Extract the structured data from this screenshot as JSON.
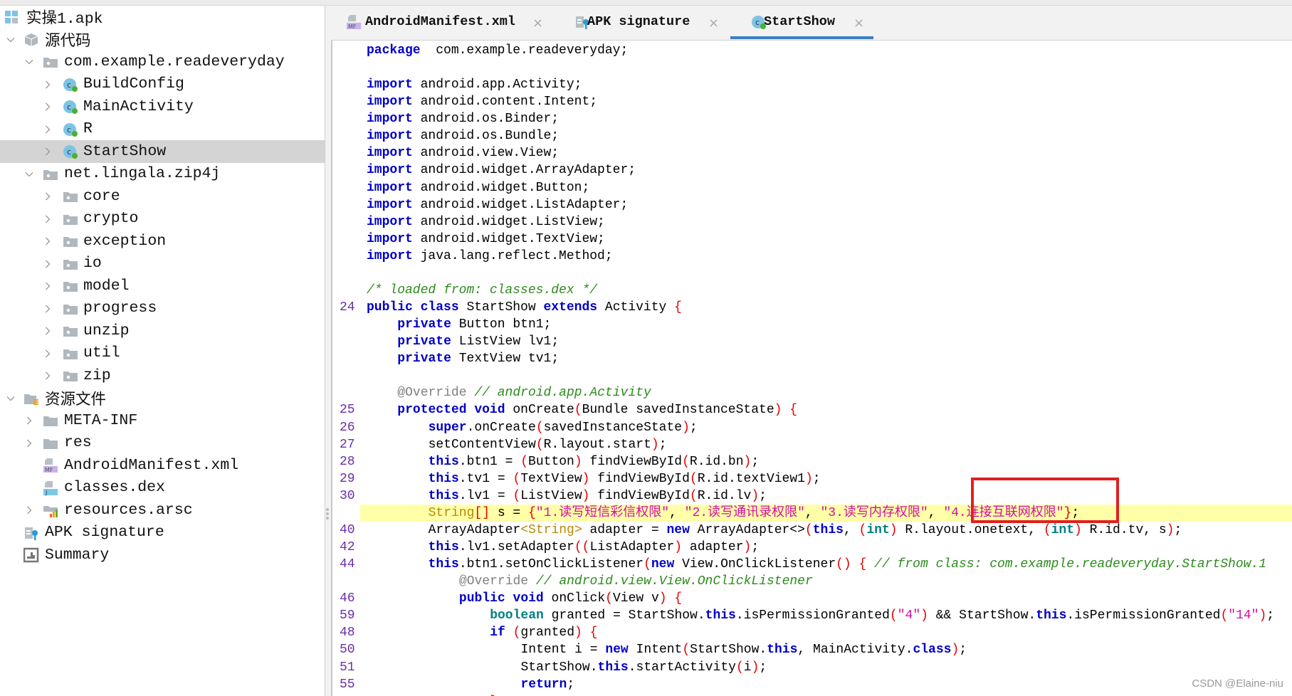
{
  "sidebar": {
    "items": [
      {
        "label": "实操1.apk",
        "level": 0,
        "chevron": "none",
        "icon": "apk-grid-icon"
      },
      {
        "label": "源代码",
        "level": 0,
        "chevron": "open",
        "icon": "source-cube-icon"
      },
      {
        "label": "com.example.readeveryday",
        "level": 1,
        "chevron": "open",
        "icon": "package-folder-icon"
      },
      {
        "label": "BuildConfig",
        "level": 2,
        "chevron": "closed",
        "icon": "class-icon"
      },
      {
        "label": "MainActivity",
        "level": 2,
        "chevron": "closed",
        "icon": "class-icon"
      },
      {
        "label": "R",
        "level": 2,
        "chevron": "closed",
        "icon": "class-icon"
      },
      {
        "label": "StartShow",
        "level": 2,
        "chevron": "closed",
        "icon": "class-icon",
        "selected": true
      },
      {
        "label": "net.lingala.zip4j",
        "level": 1,
        "chevron": "open",
        "icon": "package-folder-icon"
      },
      {
        "label": "core",
        "level": 2,
        "chevron": "closed",
        "icon": "package-folder-icon"
      },
      {
        "label": "crypto",
        "level": 2,
        "chevron": "closed",
        "icon": "package-folder-icon"
      },
      {
        "label": "exception",
        "level": 2,
        "chevron": "closed",
        "icon": "package-folder-icon"
      },
      {
        "label": "io",
        "level": 2,
        "chevron": "closed",
        "icon": "package-folder-icon"
      },
      {
        "label": "model",
        "level": 2,
        "chevron": "closed",
        "icon": "package-folder-icon"
      },
      {
        "label": "progress",
        "level": 2,
        "chevron": "closed",
        "icon": "package-folder-icon"
      },
      {
        "label": "unzip",
        "level": 2,
        "chevron": "closed",
        "icon": "package-folder-icon"
      },
      {
        "label": "util",
        "level": 2,
        "chevron": "closed",
        "icon": "package-folder-icon"
      },
      {
        "label": "zip",
        "level": 2,
        "chevron": "closed",
        "icon": "package-folder-icon"
      },
      {
        "label": "资源文件",
        "level": 0,
        "chevron": "open",
        "icon": "resources-folder-icon"
      },
      {
        "label": "META-INF",
        "level": 1,
        "chevron": "closed",
        "icon": "folder-icon"
      },
      {
        "label": "res",
        "level": 1,
        "chevron": "closed",
        "icon": "folder-icon"
      },
      {
        "label": "AndroidManifest.xml",
        "level": 1,
        "chevron": "none",
        "icon": "manifest-file-icon"
      },
      {
        "label": "classes.dex",
        "level": 1,
        "chevron": "none",
        "icon": "dex-file-icon"
      },
      {
        "label": "resources.arsc",
        "level": 1,
        "chevron": "closed",
        "icon": "arsc-file-icon"
      },
      {
        "label": "APK signature",
        "level": 0,
        "chevron": "none",
        "icon": "signature-icon"
      },
      {
        "label": "Summary",
        "level": 0,
        "chevron": "none",
        "icon": "summary-icon"
      }
    ]
  },
  "tabs": [
    {
      "label": "AndroidManifest.xml",
      "icon": "manifest-file-icon",
      "active": false,
      "close": "×"
    },
    {
      "label": "APK signature",
      "icon": "signature-icon",
      "active": false,
      "close": "×"
    },
    {
      "label": "StartShow",
      "icon": "class-icon",
      "active": true,
      "close": "×"
    }
  ],
  "colors": {
    "accent": "#3b7fc4",
    "keyword": "#0000c8",
    "string": "#d010a0",
    "comment": "#2e8b1e",
    "highlight": "#ffffa8",
    "annotation_box": "#e02020"
  },
  "editor": {
    "lines": [
      {
        "n": "",
        "i": 0,
        "t": [
          [
            "kw",
            "package"
          ],
          [
            "",
            "  com.example.readeveryday;"
          ]
        ]
      },
      {
        "n": "",
        "i": 0,
        "t": []
      },
      {
        "n": "",
        "i": 0,
        "t": [
          [
            "kw",
            "import"
          ],
          [
            "",
            " android.app.Activity;"
          ]
        ]
      },
      {
        "n": "",
        "i": 0,
        "t": [
          [
            "kw",
            "import"
          ],
          [
            "",
            " android.content.Intent;"
          ]
        ]
      },
      {
        "n": "",
        "i": 0,
        "t": [
          [
            "kw",
            "import"
          ],
          [
            "",
            " android.os.Binder;"
          ]
        ]
      },
      {
        "n": "",
        "i": 0,
        "t": [
          [
            "kw",
            "import"
          ],
          [
            "",
            " android.os.Bundle;"
          ]
        ]
      },
      {
        "n": "",
        "i": 0,
        "t": [
          [
            "kw",
            "import"
          ],
          [
            "",
            " android.view.View;"
          ]
        ]
      },
      {
        "n": "",
        "i": 0,
        "t": [
          [
            "kw",
            "import"
          ],
          [
            "",
            " android.widget.ArrayAdapter;"
          ]
        ]
      },
      {
        "n": "",
        "i": 0,
        "t": [
          [
            "kw",
            "import"
          ],
          [
            "",
            " android.widget.Button;"
          ]
        ]
      },
      {
        "n": "",
        "i": 0,
        "t": [
          [
            "kw",
            "import"
          ],
          [
            "",
            " android.widget.ListAdapter;"
          ]
        ]
      },
      {
        "n": "",
        "i": 0,
        "t": [
          [
            "kw",
            "import"
          ],
          [
            "",
            " android.widget.ListView;"
          ]
        ]
      },
      {
        "n": "",
        "i": 0,
        "t": [
          [
            "kw",
            "import"
          ],
          [
            "",
            " android.widget.TextView;"
          ]
        ]
      },
      {
        "n": "",
        "i": 0,
        "t": [
          [
            "kw",
            "import"
          ],
          [
            "",
            " java.lang.reflect.Method;"
          ]
        ]
      },
      {
        "n": "",
        "i": 0,
        "t": []
      },
      {
        "n": "",
        "i": 0,
        "t": [
          [
            "cm",
            "/* loaded from: classes.dex */"
          ]
        ]
      },
      {
        "n": "24",
        "i": 0,
        "t": [
          [
            "kw",
            "public"
          ],
          [
            "",
            " "
          ],
          [
            "kw",
            "class"
          ],
          [
            "",
            " StartShow "
          ],
          [
            "kw",
            "extends"
          ],
          [
            "",
            " Activity "
          ],
          [
            "p",
            "{"
          ]
        ]
      },
      {
        "n": "",
        "i": 1,
        "t": [
          [
            "kw",
            "private"
          ],
          [
            "",
            " Button btn1;"
          ]
        ]
      },
      {
        "n": "",
        "i": 1,
        "t": [
          [
            "kw",
            "private"
          ],
          [
            "",
            " ListView lv1;"
          ]
        ]
      },
      {
        "n": "",
        "i": 1,
        "t": [
          [
            "kw",
            "private"
          ],
          [
            "",
            " TextView tv1;"
          ]
        ]
      },
      {
        "n": "",
        "i": 0,
        "t": []
      },
      {
        "n": "",
        "i": 1,
        "t": [
          [
            "an",
            "@Override"
          ],
          [
            "",
            " "
          ],
          [
            "cm",
            "// android.app.Activity"
          ]
        ]
      },
      {
        "n": "25",
        "i": 1,
        "t": [
          [
            "kw",
            "protected"
          ],
          [
            "",
            " "
          ],
          [
            "kw",
            "void"
          ],
          [
            "",
            " onCreate"
          ],
          [
            "p",
            "("
          ],
          [
            "",
            "Bundle savedInstanceState"
          ],
          [
            "p",
            ")"
          ],
          [
            "",
            " "
          ],
          [
            "p",
            "{"
          ]
        ]
      },
      {
        "n": "26",
        "i": 2,
        "t": [
          [
            "kw",
            "super"
          ],
          [
            "",
            ".onCreate"
          ],
          [
            "p",
            "("
          ],
          [
            "",
            "savedInstanceState"
          ],
          [
            "p",
            ")"
          ],
          [
            "",
            ";"
          ]
        ]
      },
      {
        "n": "27",
        "i": 2,
        "t": [
          [
            "",
            "setContentView"
          ],
          [
            "p",
            "("
          ],
          [
            "",
            "R.layout.start"
          ],
          [
            "p",
            ")"
          ],
          [
            "",
            ";"
          ]
        ]
      },
      {
        "n": "28",
        "i": 2,
        "t": [
          [
            "kw",
            "this"
          ],
          [
            "",
            ".btn1 = "
          ],
          [
            "p",
            "("
          ],
          [
            "",
            "Button"
          ],
          [
            "p",
            ")"
          ],
          [
            "",
            " findViewById"
          ],
          [
            "p",
            "("
          ],
          [
            "",
            "R.id.bn"
          ],
          [
            "p",
            ")"
          ],
          [
            "",
            ";"
          ]
        ]
      },
      {
        "n": "29",
        "i": 2,
        "t": [
          [
            "kw",
            "this"
          ],
          [
            "",
            ".tv1 = "
          ],
          [
            "p",
            "("
          ],
          [
            "",
            "TextView"
          ],
          [
            "p",
            ")"
          ],
          [
            "",
            " findViewById"
          ],
          [
            "p",
            "("
          ],
          [
            "",
            "R.id.textView1"
          ],
          [
            "p",
            ")"
          ],
          [
            "",
            ";"
          ]
        ]
      },
      {
        "n": "30",
        "i": 2,
        "t": [
          [
            "kw",
            "this"
          ],
          [
            "",
            ".lv1 = "
          ],
          [
            "p",
            "("
          ],
          [
            "",
            "ListView"
          ],
          [
            "p",
            ")"
          ],
          [
            "",
            " findViewById"
          ],
          [
            "p",
            "("
          ],
          [
            "",
            "R.id.lv"
          ],
          [
            "p",
            ")"
          ],
          [
            "",
            ";"
          ]
        ]
      },
      {
        "n": "",
        "i": 2,
        "hl": true,
        "t": [
          [
            "gen",
            "String"
          ],
          [
            "p",
            "[]"
          ],
          [
            "",
            " s = "
          ],
          [
            "p",
            "{"
          ],
          [
            "str",
            "\"1.读写短信彩信权限\""
          ],
          [
            "",
            ", "
          ],
          [
            "str",
            "\"2.读写通讯录权限\""
          ],
          [
            "",
            ", "
          ],
          [
            "str",
            "\"3.读写内存权限\""
          ],
          [
            "",
            ", "
          ],
          [
            "str",
            "\"4.连接互联网权限\""
          ],
          [
            "p",
            "}"
          ],
          [
            "",
            ";"
          ]
        ]
      },
      {
        "n": "40",
        "i": 2,
        "t": [
          [
            "",
            "ArrayAdapter"
          ],
          [
            "gen",
            "<String>"
          ],
          [
            "",
            " adapter = "
          ],
          [
            "kw",
            "new"
          ],
          [
            "",
            " ArrayAdapter<>"
          ],
          [
            "p",
            "("
          ],
          [
            "kw",
            "this"
          ],
          [
            "",
            ", "
          ],
          [
            "p",
            "("
          ],
          [
            "ty",
            "int"
          ],
          [
            "p",
            ")"
          ],
          [
            "",
            " R.layout.onetext, "
          ],
          [
            "p",
            "("
          ],
          [
            "ty",
            "int"
          ],
          [
            "p",
            ")"
          ],
          [
            "",
            " R.id.tv, s"
          ],
          [
            "p",
            ")"
          ],
          [
            "",
            ";"
          ]
        ]
      },
      {
        "n": "42",
        "i": 2,
        "t": [
          [
            "kw",
            "this"
          ],
          [
            "",
            ".lv1.setAdapter"
          ],
          [
            "p",
            "(("
          ],
          [
            "",
            "ListAdapter"
          ],
          [
            "p",
            ")"
          ],
          [
            "",
            " adapter"
          ],
          [
            "p",
            ")"
          ],
          [
            "",
            ";"
          ]
        ]
      },
      {
        "n": "44",
        "i": 2,
        "t": [
          [
            "kw",
            "this"
          ],
          [
            "",
            ".btn1.setOnClickListener"
          ],
          [
            "p",
            "("
          ],
          [
            "kw",
            "new"
          ],
          [
            "",
            " View.OnClickListener"
          ],
          [
            "p",
            "()"
          ],
          [
            "",
            " "
          ],
          [
            "p",
            "{"
          ],
          [
            "",
            " "
          ],
          [
            "cm",
            "// from class: com.example.readeveryday.StartShow.1"
          ]
        ]
      },
      {
        "n": "",
        "i": 3,
        "t": [
          [
            "an",
            "@Override"
          ],
          [
            "",
            " "
          ],
          [
            "cm",
            "// android.view.View.OnClickListener"
          ]
        ]
      },
      {
        "n": "46",
        "i": 3,
        "t": [
          [
            "kw",
            "public"
          ],
          [
            "",
            " "
          ],
          [
            "kw",
            "void"
          ],
          [
            "",
            " onClick"
          ],
          [
            "p",
            "("
          ],
          [
            "",
            "View v"
          ],
          [
            "p",
            ")"
          ],
          [
            "",
            " "
          ],
          [
            "p",
            "{"
          ]
        ]
      },
      {
        "n": "59",
        "i": 4,
        "t": [
          [
            "ty",
            "boolean"
          ],
          [
            "",
            " granted = StartShow."
          ],
          [
            "kw",
            "this"
          ],
          [
            "",
            ".isPermissionGranted"
          ],
          [
            "p",
            "("
          ],
          [
            "str",
            "\"4\""
          ],
          [
            "p",
            ")"
          ],
          [
            "",
            " && StartShow."
          ],
          [
            "kw",
            "this"
          ],
          [
            "",
            ".isPermissionGranted"
          ],
          [
            "p",
            "("
          ],
          [
            "str",
            "\"14\""
          ],
          [
            "p",
            ")"
          ],
          [
            "",
            ";"
          ]
        ]
      },
      {
        "n": "48",
        "i": 4,
        "t": [
          [
            "kw",
            "if"
          ],
          [
            "",
            " "
          ],
          [
            "p",
            "("
          ],
          [
            "",
            "granted"
          ],
          [
            "p",
            ")"
          ],
          [
            "",
            " "
          ],
          [
            "p",
            "{"
          ]
        ]
      },
      {
        "n": "50",
        "i": 5,
        "t": [
          [
            "",
            "Intent i = "
          ],
          [
            "kw",
            "new"
          ],
          [
            "",
            " Intent"
          ],
          [
            "p",
            "("
          ],
          [
            "",
            "StartShow."
          ],
          [
            "kw",
            "this"
          ],
          [
            "",
            ", MainActivity."
          ],
          [
            "kw",
            "class"
          ],
          [
            "p",
            ")"
          ],
          [
            "",
            ";"
          ]
        ]
      },
      {
        "n": "51",
        "i": 5,
        "t": [
          [
            "",
            "StartShow."
          ],
          [
            "kw",
            "this"
          ],
          [
            "",
            ".startActivity"
          ],
          [
            "p",
            "("
          ],
          [
            "",
            "i"
          ],
          [
            "p",
            ")"
          ],
          [
            "",
            ";"
          ]
        ]
      },
      {
        "n": "55",
        "i": 5,
        "t": [
          [
            "kw",
            "return"
          ],
          [
            "",
            ";"
          ]
        ]
      },
      {
        "n": "",
        "i": 4,
        "t": [
          [
            "p",
            "}"
          ]
        ]
      }
    ]
  },
  "watermark": "CSDN @Elaine-niu"
}
